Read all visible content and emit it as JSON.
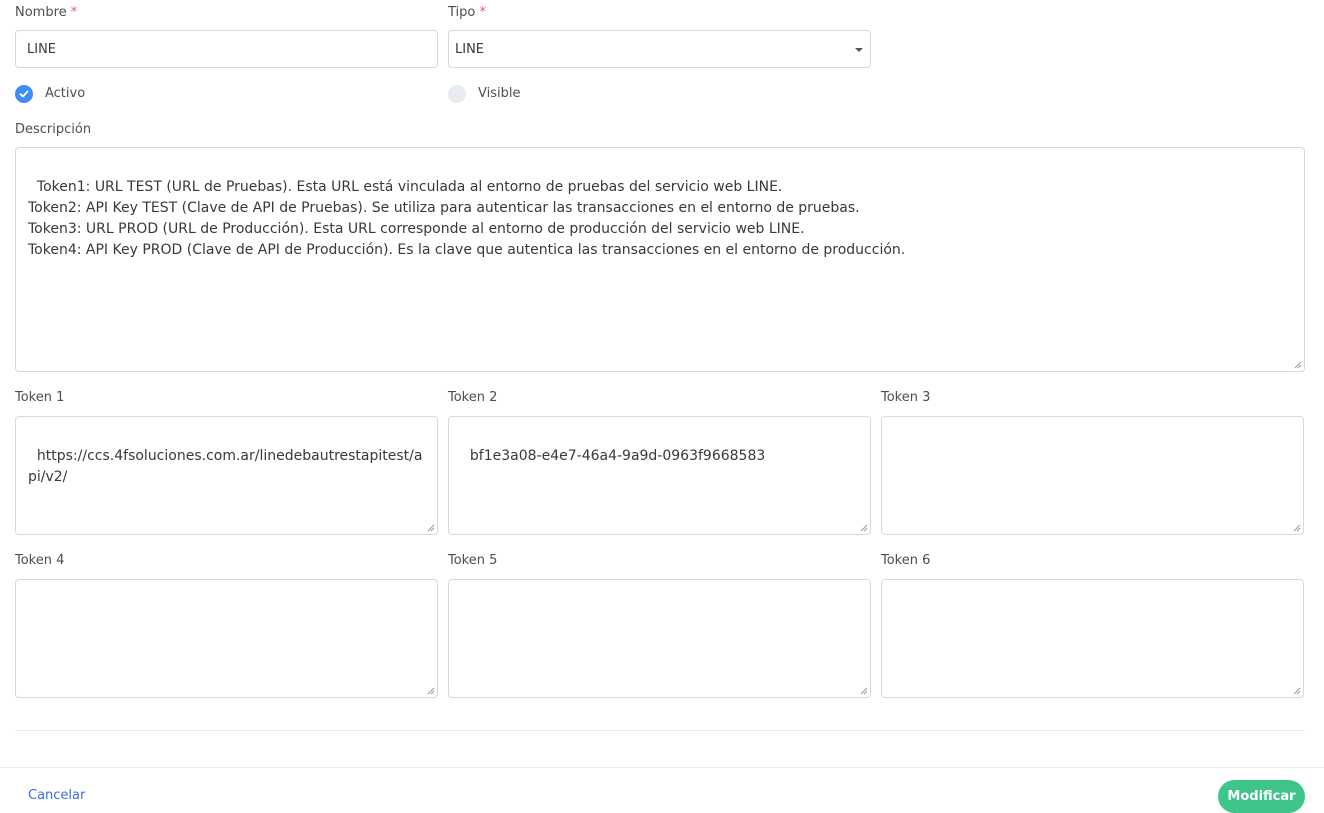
{
  "form": {
    "nombre": {
      "label": "Nombre",
      "required_mark": "*",
      "value": "LINE"
    },
    "tipo": {
      "label": "Tipo",
      "required_mark": "*",
      "value": "LINE"
    },
    "activo": {
      "label": "Activo",
      "checked": true
    },
    "visible": {
      "label": "Visible",
      "checked": false
    },
    "descripcion": {
      "label": "Descripción",
      "value": "Token1: URL TEST (URL de Pruebas). Esta URL está vinculada al entorno de pruebas del servicio web LINE.\nToken2: API Key TEST (Clave de API de Pruebas). Se utiliza para autenticar las transacciones en el entorno de pruebas.\nToken3: URL PROD (URL de Producción). Esta URL corresponde al entorno de producción del servicio web LINE.\nToken4: API Key PROD (Clave de API de Producción). Es la clave que autentica las transacciones en el entorno de producción."
    },
    "tokens": [
      {
        "label": "Token 1",
        "value": "https://ccs.4fsoluciones.com.ar/linedebautrestapitest/api/v2/"
      },
      {
        "label": "Token 2",
        "value": "bf1e3a08-e4e7-46a4-9a9d-0963f9668583"
      },
      {
        "label": "Token 3",
        "value": ""
      },
      {
        "label": "Token 4",
        "value": ""
      },
      {
        "label": "Token 5",
        "value": ""
      },
      {
        "label": "Token 6",
        "value": ""
      }
    ]
  },
  "footer": {
    "cancel_label": "Cancelar",
    "submit_label": "Modificar"
  },
  "colors": {
    "accent": "#3f8cf3",
    "submit": "#3fc48a",
    "required": "#f1556c",
    "link": "#3d6fd1"
  }
}
